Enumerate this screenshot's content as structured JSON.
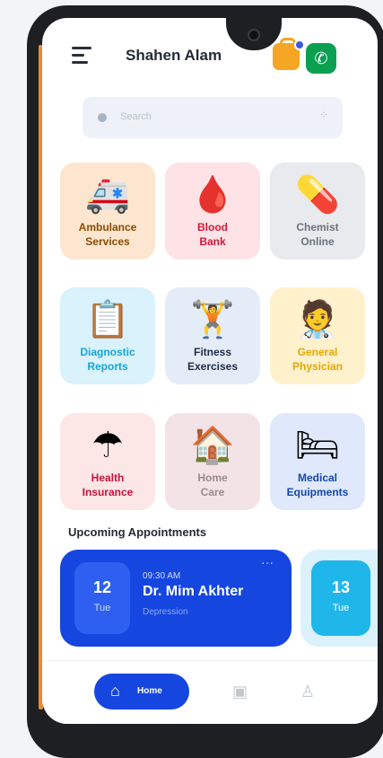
{
  "header": {
    "user_name": "Shahen Alam"
  },
  "search": {
    "placeholder": "Search"
  },
  "services": [
    {
      "label": "Ambulance\nServices",
      "icon": "ambulance-icon",
      "bg": "#fde6cf",
      "color": "#8a4a00"
    },
    {
      "label": "Blood\nBank",
      "icon": "blood-bag-icon",
      "bg": "#fde3e6",
      "color": "#d2183a"
    },
    {
      "label": "Chemist\nOnline",
      "icon": "pills-icon",
      "bg": "#e9eaed",
      "color": "#6b7280"
    },
    {
      "label": "Diagnostic\nReports",
      "icon": "clipboard-heart-icon",
      "bg": "#d9f2fb",
      "color": "#16a5d6"
    },
    {
      "label": "Fitness\nExercises",
      "icon": "fitness-icon",
      "bg": "#e4edf7",
      "color": "#1f2a44"
    },
    {
      "label": "General\nPhysician",
      "icon": "doctor-icon",
      "bg": "#fff1cc",
      "color": "#e6a700"
    },
    {
      "label": "Health\nInsurance",
      "icon": "umbrella-heart-icon",
      "bg": "#fde6e6",
      "color": "#c8143a"
    },
    {
      "label": "Home\nCare",
      "icon": "home-care-icon",
      "bg": "#f3e3e7",
      "color": "#9a8a8e"
    },
    {
      "label": "Medical\nEquipments",
      "icon": "hospital-bed-icon",
      "bg": "#dfe9fb",
      "color": "#1546a8"
    }
  ],
  "appointments": {
    "title": "Upcoming Appointments",
    "items": [
      {
        "day": "12",
        "weekday": "Tue",
        "time": "09:30 AM",
        "doctor": "Dr. Mim Akhter",
        "specialty": "Depression"
      },
      {
        "day": "13",
        "weekday": "Tue"
      }
    ]
  },
  "nav": {
    "home_label": "Home"
  },
  "colors": {
    "primary": "#1546e0",
    "call": "#0aa052",
    "bag": "#f5a623"
  }
}
